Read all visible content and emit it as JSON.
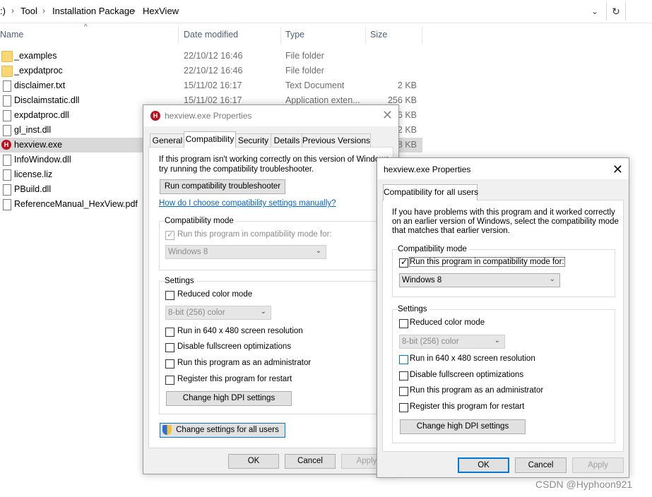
{
  "explorer": {
    "breadcrumb": [
      ":)",
      "Tool",
      "Installation Package",
      "HexView"
    ],
    "columns": {
      "name": "Name",
      "date": "Date modified",
      "type": "Type",
      "size": "Size"
    },
    "files": [
      {
        "name": "_examples",
        "date": "22/10/12 16:46",
        "type": "File folder",
        "size": "",
        "icon": "folder-icon"
      },
      {
        "name": "_expdatproc",
        "date": "22/10/12 16:46",
        "type": "File folder",
        "size": "",
        "icon": "folder-icon"
      },
      {
        "name": "disclaimer.txt",
        "date": "15/11/02 16:17",
        "type": "Text Document",
        "size": "2 KB",
        "icon": "text-file-icon"
      },
      {
        "name": "Disclaimstatic.dll",
        "date": "15/11/02 16:17",
        "type": "Application exten...",
        "size": "256 KB",
        "icon": "dll-file-icon"
      },
      {
        "name": "expdatproc.dll",
        "date": "",
        "type": "",
        "size": "?6 KB",
        "icon": "dll-file-icon"
      },
      {
        "name": "gl_inst.dll",
        "date": "",
        "type": "",
        "size": "?2 KB",
        "icon": "dll-file-icon"
      },
      {
        "name": "hexview.exe",
        "date": "",
        "type": "",
        "size": "58 KB",
        "icon": "hexview-app-icon"
      },
      {
        "name": "InfoWindow.dll",
        "date": "",
        "type": "",
        "size": "",
        "icon": "dll-file-icon"
      },
      {
        "name": "license.liz",
        "date": "",
        "type": "",
        "size": "",
        "icon": "file-icon"
      },
      {
        "name": "PBuild.dll",
        "date": "",
        "type": "",
        "size": "",
        "icon": "dll-file-icon"
      },
      {
        "name": "ReferenceManual_HexView.pdf",
        "date": "",
        "type": "",
        "size": "",
        "icon": "pdf-file-icon"
      }
    ]
  },
  "props_dialog": {
    "title": "hexview.exe Properties",
    "tabs": [
      "General",
      "Compatibility",
      "Security",
      "Details",
      "Previous Versions"
    ],
    "intro": [
      "If this program isn't working correctly on this version of Windows,",
      "try running the compatibility troubleshooter."
    ],
    "troubleshooter_button": "Run compatibility troubleshooter",
    "manual_link": "How do I choose compatibility settings manually?",
    "compat_group": "Compatibility mode",
    "compat_check": "Run this program in compatibility mode for:",
    "compat_value": "Windows 8",
    "settings_group": "Settings",
    "reduced_color": "Reduced color mode",
    "color_value": "8-bit (256) color",
    "res_640": "Run in 640 x 480 screen resolution",
    "fullscreen": "Disable fullscreen optimizations",
    "admin": "Run this program as an administrator",
    "restart": "Register this program for restart",
    "dpi_button": "Change high DPI settings",
    "all_users_button": "Change settings for all users",
    "ok": "OK",
    "cancel": "Cancel",
    "apply": "Apply"
  },
  "all_users_dialog": {
    "title": "hexview.exe Properties",
    "tab": "Compatibility for all users",
    "intro": [
      "If you have problems with this program and it worked correctly",
      "on an earlier version of Windows, select the compatibility mode",
      "that matches that earlier version."
    ],
    "compat_group": "Compatibility mode",
    "compat_check": "Run this program in compatibility mode for:",
    "compat_value": "Windows 8",
    "settings_group": "Settings",
    "reduced_color": "Reduced color mode",
    "color_value": "8-bit (256) color",
    "res_640": "Run in 640 x 480 screen resolution",
    "fullscreen": "Disable fullscreen optimizations",
    "admin": "Run this program as an administrator",
    "restart": "Register this program for restart",
    "dpi_button": "Change high DPI settings",
    "ok": "OK",
    "cancel": "Cancel",
    "apply": "Apply"
  },
  "watermark": "CSDN @Hyphoon921"
}
